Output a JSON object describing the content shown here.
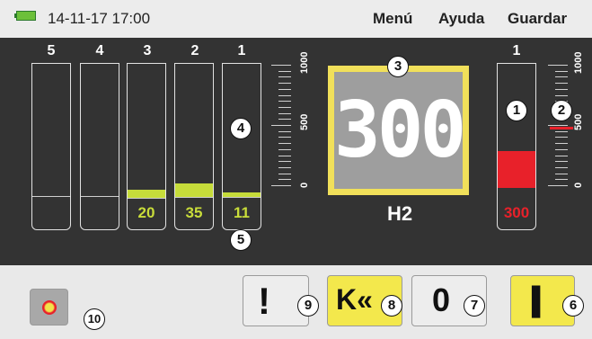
{
  "topbar": {
    "datetime": "14-11-17 17:00",
    "menu": [
      "Menú",
      "Ayuda",
      "Guardar"
    ],
    "battery_icon": "battery-icon"
  },
  "channels": [
    {
      "number": "5",
      "value": ""
    },
    {
      "number": "4",
      "value": ""
    },
    {
      "number": "3",
      "value": "20"
    },
    {
      "number": "2",
      "value": "35"
    },
    {
      "number": "1",
      "value": "11"
    }
  ],
  "scale_left": [
    "1000",
    "500",
    "0"
  ],
  "display": {
    "value": "300",
    "gas": "H2"
  },
  "right_channel": {
    "number": "1",
    "value": "300"
  },
  "scale_right": [
    "1000",
    "500",
    "0"
  ],
  "callouts": [
    "1",
    "2",
    "3",
    "4",
    "5",
    "6",
    "7",
    "8",
    "9",
    "10"
  ],
  "buttons": {
    "alarm": "!",
    "zero": "0",
    "back": "K«",
    "pause": "||"
  },
  "colors": {
    "panel": "#333333",
    "accent_yellow": "#f1e05a",
    "alarm_red": "#e8212a",
    "lime": "#c6dc3a"
  }
}
